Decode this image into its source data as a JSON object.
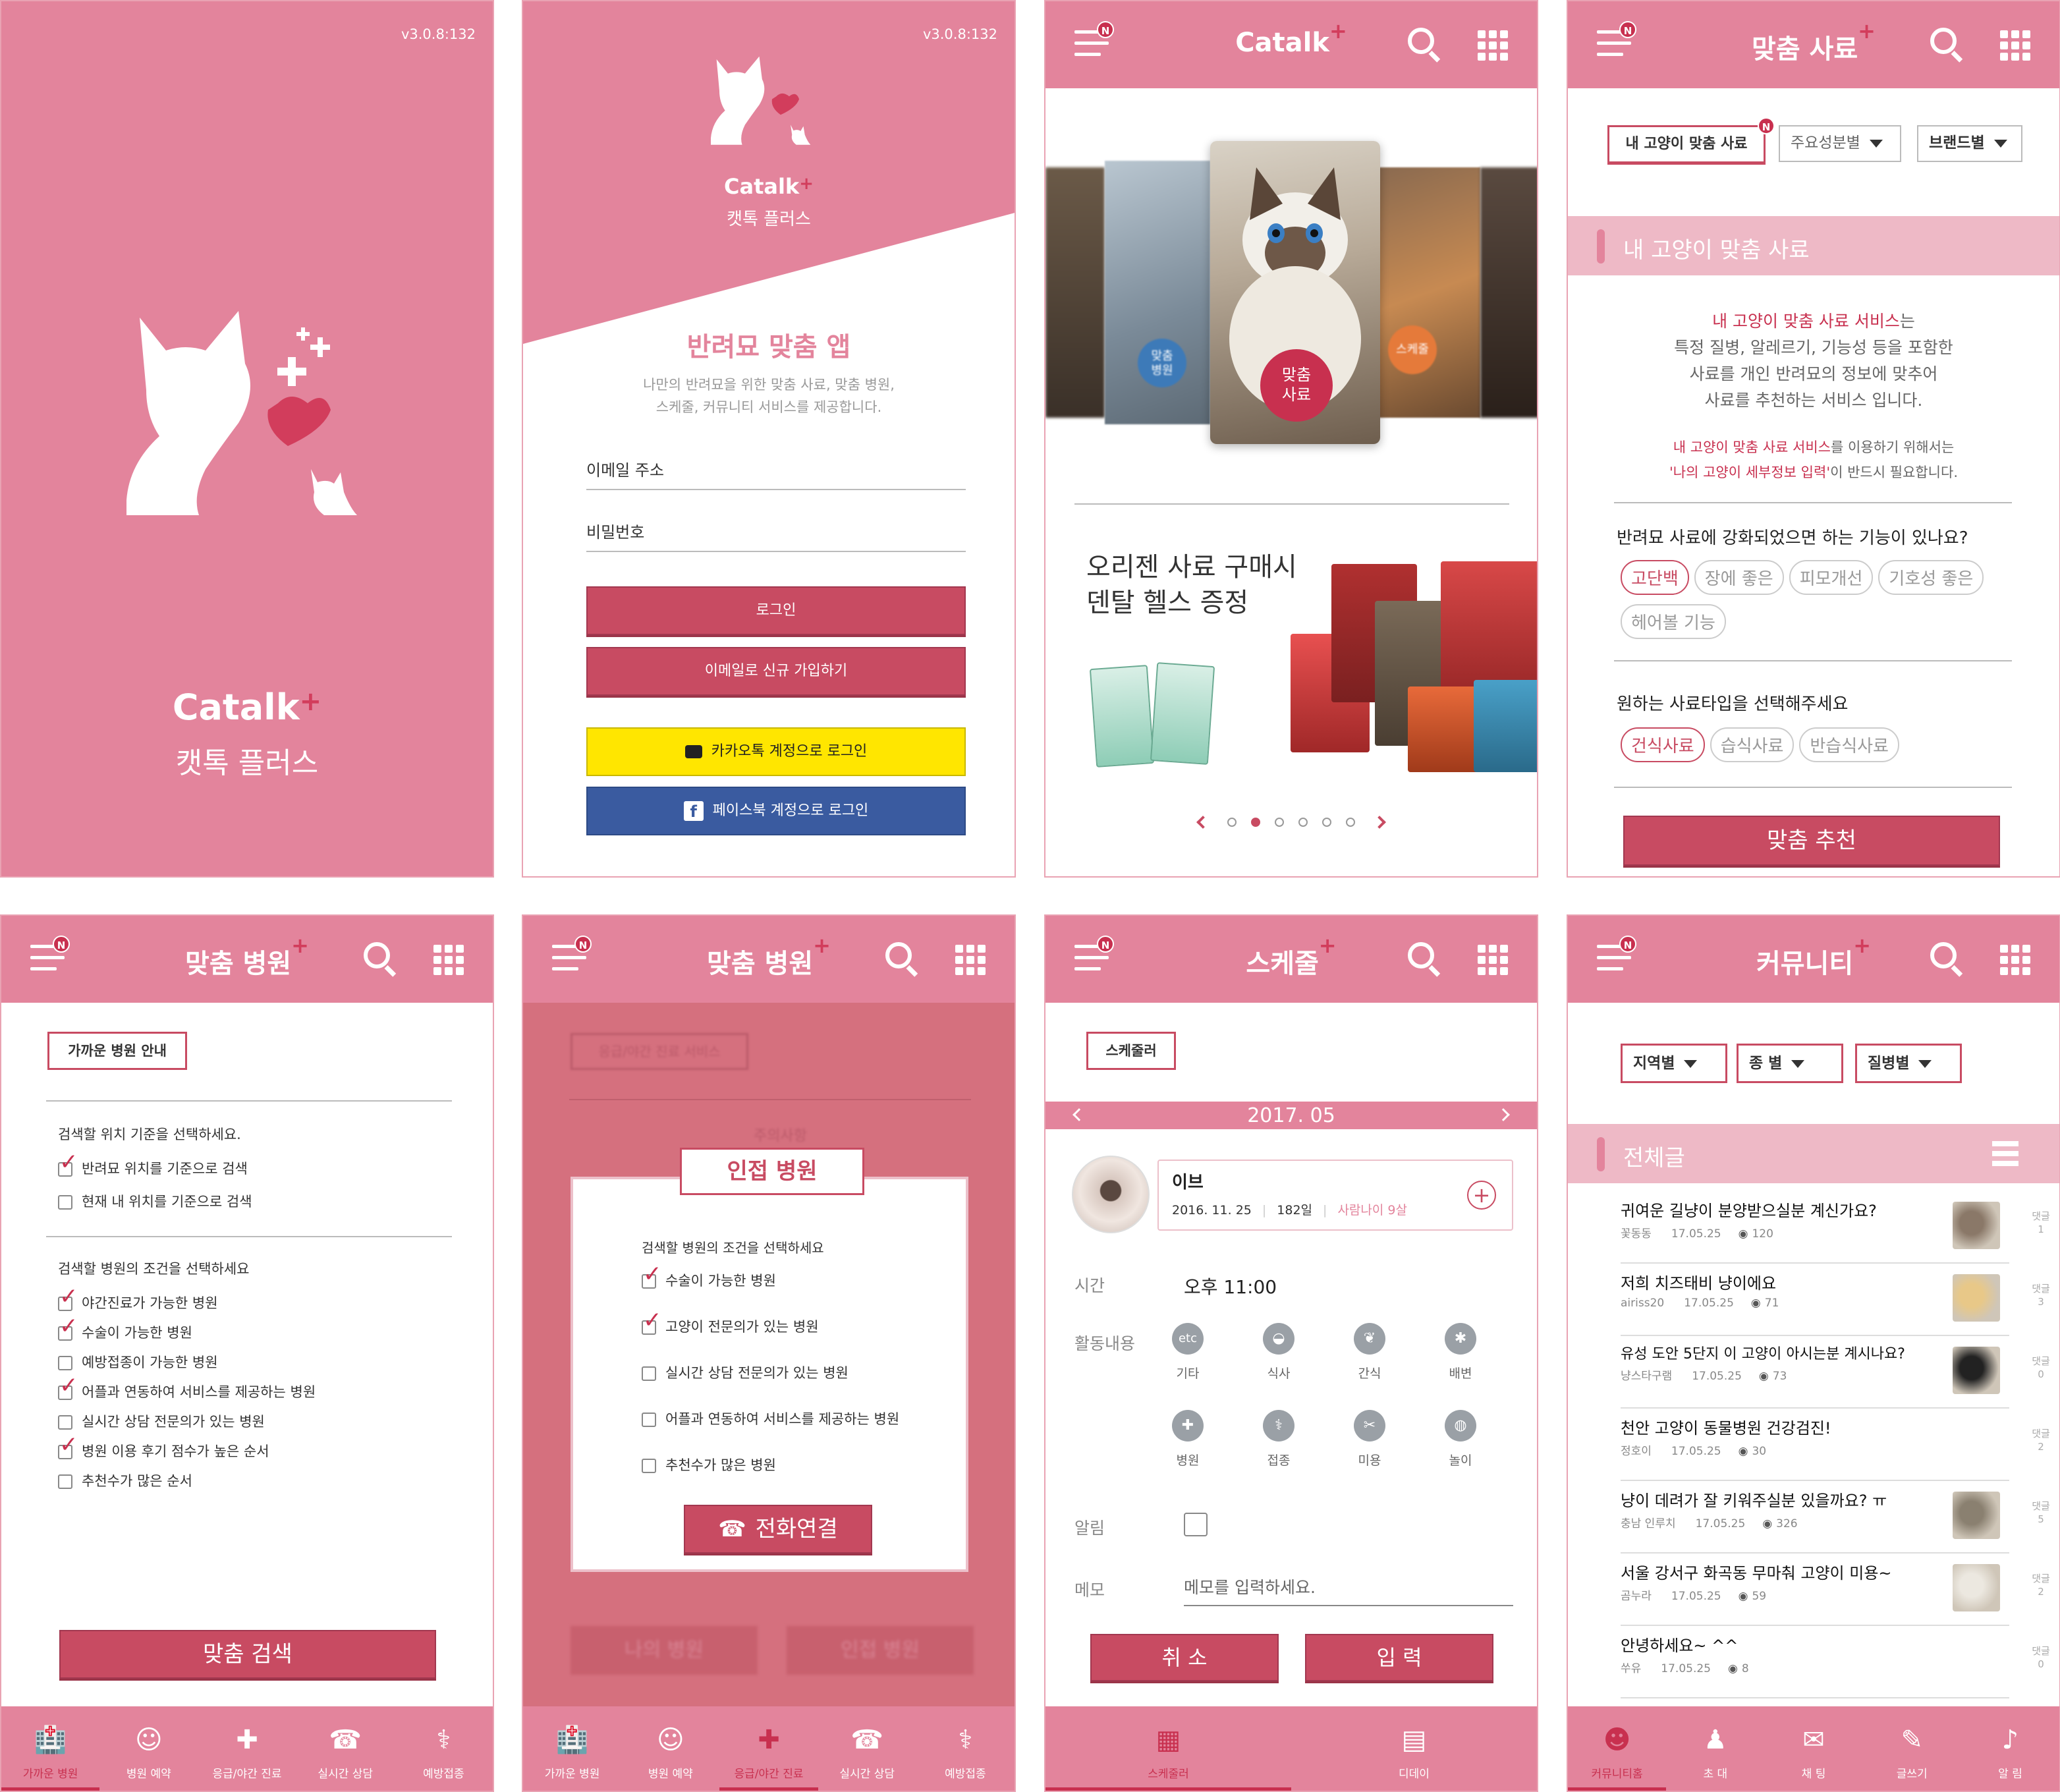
{
  "colors": {
    "brand_pink": "#e3849c",
    "accent_red": "#c84b62",
    "badge_red": "#c8304f",
    "kakao": "#ffe600",
    "facebook": "#3a5ba0"
  },
  "splash": {
    "version": "v3.0.8:132",
    "logo": "Catalk",
    "logo_plus": "+",
    "logo_sub": "캣톡 플러스"
  },
  "login": {
    "version": "v3.0.8:132",
    "logo": "Catalk",
    "logo_plus": "+",
    "logo_sub": "캣톡 플러스",
    "headline": "반려묘 맞춤 앱",
    "desc1": "나만의 반려묘을 위한 맞춤 사료, 맞춤 병원,",
    "desc2": "스케줄, 커뮤니티 서비스를 제공합니다.",
    "email_ph": "이메일 주소",
    "password_ph": "비밀번호",
    "login_btn": "로그인",
    "signup_btn": "이메일로 신규 가입하기",
    "kakao_btn": "카카오톡 계정으로 로그인",
    "facebook_btn": "페이스북 계정으로 로그인"
  },
  "home": {
    "title": "Catalk",
    "title_plus": "+",
    "badge": "N",
    "cards": [
      {
        "label": "맞춤\n병원"
      },
      {
        "label": "맞춤\n사료"
      },
      {
        "label": "스케줄"
      }
    ],
    "promo_line1": "오리젠 사료 구매시",
    "promo_line2": "덴탈 헬스 증정",
    "pager_total": 6,
    "pager_active": 2
  },
  "food": {
    "title": "맞춤 사료",
    "badge": "N",
    "tabs": [
      "내 고양이 맞춤 사료",
      "주요성분별",
      "브랜드별"
    ],
    "section": "내 고양이 맞춤 사료",
    "intro_hl": "내 고양이 맞춤 사료 서비스",
    "intro_rest": "는",
    "intro2": "특정 질병, 알레르기, 기능성 등을 포함한",
    "intro3": "사료를 개인 반려묘의 정보에 맞추어",
    "intro4": "사료를 추천하는 서비스 입니다.",
    "note_hl": "내 고양이 맞춤 사료 서비스",
    "note_rest": "를 이용하기 위해서는",
    "note2_hl": "'나의 고양이 세부정보 입력'",
    "note2_rest": "이 반드시 필요합니다.",
    "q1": "반려묘 사료에 강화되었으면 하는 기능이 있나요?",
    "q1_options": [
      "고단백",
      "장에 좋은",
      "피모개선",
      "기호성 좋은",
      "헤어볼 기능"
    ],
    "q2": "원하는 사료타입을 선택해주세요",
    "q2_options": [
      "건식사료",
      "습식사료",
      "반습식사료"
    ],
    "cta": "맞춤 추천"
  },
  "hospital": {
    "title": "맞춤 병원",
    "badge": "N",
    "guide_btn": "가까운 병원 안내",
    "q1": "검색할 위치 기준을 선택하세요.",
    "q1_opts": [
      {
        "label": "반려묘 위치를 기준으로 검색",
        "checked": true
      },
      {
        "label": "현재 내 위치를 기준으로 검색",
        "checked": false
      }
    ],
    "q2": "검색할 병원의 조건을 선택하세요",
    "q2_opts": [
      {
        "label": "야간진료가 가능한 병원",
        "checked": true
      },
      {
        "label": "수술이 가능한 병원",
        "checked": true
      },
      {
        "label": "예방접종이 가능한 병원",
        "checked": false
      },
      {
        "label": "어플과 연동하여 서비스를 제공하는 병원",
        "checked": true
      },
      {
        "label": "실시간 상담 전문의가 있는 병원",
        "checked": false
      },
      {
        "label": "병원 이용 후기 점수가 높은 순서",
        "checked": true
      },
      {
        "label": "추천수가 많은 순서",
        "checked": false
      }
    ],
    "cta": "맞춤 검색",
    "nav": [
      "가까운 병원",
      "병원 예약",
      "응급/야간 진료",
      "실시간 상담",
      "예방접종"
    ]
  },
  "nearby": {
    "title": "맞춤 병원",
    "badge": "N",
    "bg_btn": "응급/야간 진료 서비스",
    "bg_text": "주의사항",
    "modal_title": "인접 병원",
    "modal_q": "검색할 병원의 조건을 선택하세요",
    "modal_opts": [
      {
        "label": "수술이 가능한 병원",
        "checked": true
      },
      {
        "label": "고양이 전문의가 있는 병원",
        "checked": true
      },
      {
        "label": "실시간 상담 전문의가 있는 병원",
        "checked": false
      },
      {
        "label": "어플과 연동하여 서비스를 제공하는 병원",
        "checked": false
      },
      {
        "label": "추천수가 많은 병원",
        "checked": false
      }
    ],
    "call_btn": "전화연결",
    "bg_btn_left": "나의 병원",
    "bg_btn_right": "인접 병원",
    "nav": [
      "가까운 병원",
      "병원 예약",
      "응급/야간 진료",
      "실시간 상담",
      "예방접종"
    ]
  },
  "schedule": {
    "title": "스케줄",
    "badge": "N",
    "tab": "스케줄러",
    "month": "2017. 05",
    "cat_name": "이브",
    "birth": "2016. 11. 25",
    "days": "182일",
    "human_age": "사람나이 9살",
    "time_label": "시간",
    "time_value": "오후 11:00",
    "activity_label": "활동내용",
    "activities": [
      {
        "icon": "etc",
        "label": "기타"
      },
      {
        "icon": "bowl",
        "label": "식사"
      },
      {
        "icon": "treat",
        "label": "간식"
      },
      {
        "icon": "litter",
        "label": "배변"
      },
      {
        "icon": "clinic",
        "label": "병원"
      },
      {
        "icon": "syringe",
        "label": "접종"
      },
      {
        "icon": "brush",
        "label": "미용"
      },
      {
        "icon": "yarn",
        "label": "놀이"
      }
    ],
    "alarm_label": "알림",
    "memo_label": "메모",
    "memo_ph": "메모를 입력하세요.",
    "cancel": "취 소",
    "submit": "입 력",
    "nav": [
      "스케줄러",
      "디데이"
    ]
  },
  "community": {
    "title": "커뮤니티",
    "badge": "N",
    "filters": [
      "지역별",
      "종 별",
      "질병별"
    ],
    "section": "전체글",
    "posts": [
      {
        "title": "귀여운 길냥이 분양받으실분 계신가요?",
        "author": "꽃동동",
        "date": "17.05.25",
        "views": "120",
        "comments": "1"
      },
      {
        "title": "저희 치즈태비 냥이에요",
        "author": "airiss20",
        "date": "17.05.25",
        "views": "71",
        "comments": "3"
      },
      {
        "title": "유성 도안 5단지 이 고양이 아시는분 계시나요?",
        "author": "냥스타구램",
        "date": "17.05.25",
        "views": "73",
        "comments": "0"
      },
      {
        "title": "천안 고양이 동물병원 건강검진!",
        "author": "정호이",
        "date": "17.05.25",
        "views": "30",
        "comments": "2"
      },
      {
        "title": "냥이 데려가 잘 키워주실분 있을까요? ㅠ",
        "author": "충남 인루치",
        "date": "17.05.25",
        "views": "326",
        "comments": "5"
      },
      {
        "title": "서울 강서구 화곡동 무마춰 고양이 미용~",
        "author": "곰누라",
        "date": "17.05.25",
        "views": "59",
        "comments": "2"
      },
      {
        "title": "안녕하세요~ ^^",
        "author": "쑤유",
        "date": "17.05.25",
        "views": "8",
        "comments": "0"
      }
    ],
    "comment_label": "댓글",
    "nav": [
      "커뮤니티홈",
      "초 대",
      "채 팅",
      "글쓰기",
      "알 림"
    ]
  }
}
